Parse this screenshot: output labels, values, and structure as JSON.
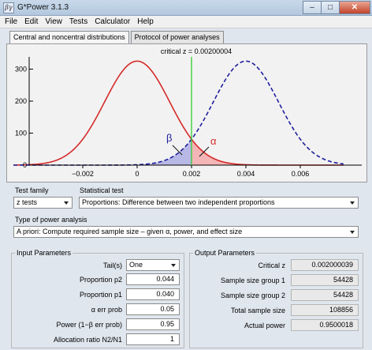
{
  "window": {
    "icon_text": "βγ",
    "title": "G*Power 3.1.3"
  },
  "menu": [
    "File",
    "Edit",
    "View",
    "Tests",
    "Calculator",
    "Help"
  ],
  "tabs": [
    "Central and noncentral distributions",
    "Protocol of power analyses"
  ],
  "plot": {
    "critical_label": "critical z = 0.00200004",
    "beta_symbol": "β",
    "alpha_symbol": "α",
    "y_tick_labels": [
      "300",
      "200",
      "100",
      "0"
    ],
    "x_tick_labels": [
      "−0.002",
      "0",
      "0.002",
      "0.004",
      "0.006"
    ],
    "colors": {
      "null_curve": "#d62a2a",
      "alt_curve": "#1f1f9e",
      "critical_line": "#3ccf3c",
      "alpha_fill": "#f3b5b5",
      "beta_fill": "#b8b8e6"
    }
  },
  "test_family": {
    "label": "Test family",
    "value": "z tests"
  },
  "statistical_test": {
    "label": "Statistical test",
    "value": "Proportions: Difference between two independent proportions"
  },
  "power_analysis": {
    "label": "Type of power analysis",
    "value": "A priori: Compute required sample size – given α, power, and effect size"
  },
  "input_params": {
    "title": "Input Parameters",
    "tails": {
      "label": "Tail(s)",
      "value": "One"
    },
    "fields": [
      {
        "label": "Proportion p2",
        "value": "0.044"
      },
      {
        "label": "Proportion p1",
        "value": "0.040"
      },
      {
        "label": "α err prob",
        "value": "0.05"
      },
      {
        "label": "Power (1−β err prob)",
        "value": "0.95"
      },
      {
        "label": "Allocation ratio N2/N1",
        "value": "1"
      }
    ]
  },
  "output_params": {
    "title": "Output Parameters",
    "fields": [
      {
        "label": "Critical z",
        "value": "0.002000039"
      },
      {
        "label": "Sample size group 1",
        "value": "54428"
      },
      {
        "label": "Sample size group 2",
        "value": "54428"
      },
      {
        "label": "Total sample size",
        "value": "108856"
      },
      {
        "label": "Actual power",
        "value": "0.9500018"
      }
    ]
  }
}
